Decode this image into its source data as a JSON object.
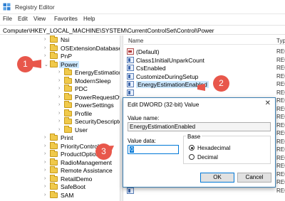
{
  "window": {
    "title": "Registry Editor"
  },
  "menu": [
    "File",
    "Edit",
    "View",
    "Favorites",
    "Help"
  ],
  "address": "Computer\\HKEY_LOCAL_MACHINE\\SYSTEM\\CurrentControlSet\\Control\\Power",
  "tree": [
    {
      "label": "Nsi",
      "expanded": false,
      "selected": false
    },
    {
      "label": "OSExtensionDatabase",
      "expanded": false,
      "selected": false
    },
    {
      "label": "PnP",
      "expanded": false,
      "selected": false
    },
    {
      "label": "Power",
      "expanded": true,
      "selected": true
    },
    {
      "label": "EnergyEstimation",
      "expanded": false,
      "selected": false
    },
    {
      "label": "ModernSleep",
      "expanded": false,
      "selected": false
    },
    {
      "label": "PDC",
      "expanded": false,
      "selected": false
    },
    {
      "label": "PowerRequestOver",
      "expanded": false,
      "selected": false
    },
    {
      "label": "PowerSettings",
      "expanded": false,
      "selected": false
    },
    {
      "label": "Profile",
      "expanded": false,
      "selected": false
    },
    {
      "label": "SecurityDescriptors",
      "expanded": false,
      "selected": false
    },
    {
      "label": "User",
      "expanded": false,
      "selected": false
    },
    {
      "label": "Print",
      "expanded": false,
      "selected": false
    },
    {
      "label": "PriorityControl",
      "expanded": false,
      "selected": false
    },
    {
      "label": "ProductOptions",
      "expanded": false,
      "selected": false
    },
    {
      "label": "RadioManagement",
      "expanded": false,
      "selected": false
    },
    {
      "label": "Remote Assistance",
      "expanded": false,
      "selected": false
    },
    {
      "label": "RetailDemo",
      "expanded": false,
      "selected": false
    },
    {
      "label": "SafeBoot",
      "expanded": false,
      "selected": false
    },
    {
      "label": "SAM",
      "expanded": false,
      "selected": false
    }
  ],
  "list": {
    "name_header": "Name",
    "type_header": "Typ",
    "rows": [
      {
        "name": "(Default)",
        "type": "REG",
        "icon": "string-value-icon",
        "selected": false
      },
      {
        "name": "Class1InitialUnparkCount",
        "type": "REG",
        "icon": "dword-value-icon",
        "selected": false
      },
      {
        "name": "CsEnabled",
        "type": "REG",
        "icon": "dword-value-icon",
        "selected": false
      },
      {
        "name": "CustomizeDuringSetup",
        "type": "REG",
        "icon": "dword-value-icon",
        "selected": false
      },
      {
        "name": "EnergyEstimationEnabled",
        "type": "REG",
        "icon": "dword-value-icon",
        "selected": true
      },
      {
        "name": "",
        "type": "REG",
        "icon": "dword-value-icon",
        "selected": false
      },
      {
        "name": "",
        "type": "REG",
        "icon": "dword-value-icon",
        "selected": false
      },
      {
        "name": "",
        "type": "REG",
        "icon": "dword-value-icon",
        "selected": false
      },
      {
        "name": "",
        "type": "REG",
        "icon": "dword-value-icon",
        "selected": false
      },
      {
        "name": "",
        "type": "REG",
        "icon": "dword-value-icon",
        "selected": false
      },
      {
        "name": "",
        "type": "REG",
        "icon": "dword-value-icon",
        "selected": false
      },
      {
        "name": "",
        "type": "REG",
        "icon": "dword-value-icon",
        "selected": false
      },
      {
        "name": "",
        "type": "REG",
        "icon": "dword-value-icon",
        "selected": false
      },
      {
        "name": "",
        "type": "REG",
        "icon": "dword-value-icon",
        "selected": false
      },
      {
        "name": "",
        "type": "REG",
        "icon": "dword-value-icon",
        "selected": false
      },
      {
        "name": "",
        "type": "REG",
        "icon": "dword-value-icon",
        "selected": false
      },
      {
        "name": "",
        "type": "REG",
        "icon": "dword-value-icon",
        "selected": false
      },
      {
        "name": "",
        "type": "REG",
        "icon": "dword-value-icon",
        "selected": false
      }
    ]
  },
  "dialog": {
    "title": "Edit DWORD (32-bit) Value",
    "close_glyph": "✕",
    "value_name_label": "Value name:",
    "value_name": "EnergyEstimationEnabled",
    "value_data_label": "Value data:",
    "value_data": "0",
    "base_label": "Base",
    "hex_label": "Hexadecimal",
    "dec_label": "Decimal",
    "base_selected": "Hexadecimal",
    "ok_label": "OK",
    "cancel_label": "Cancel"
  },
  "callouts": [
    "1",
    "2",
    "3"
  ],
  "colors": {
    "callout": "#e8574b",
    "selection": "#cce8ff",
    "folder": "#f0c94a",
    "accent": "#0078d7"
  }
}
